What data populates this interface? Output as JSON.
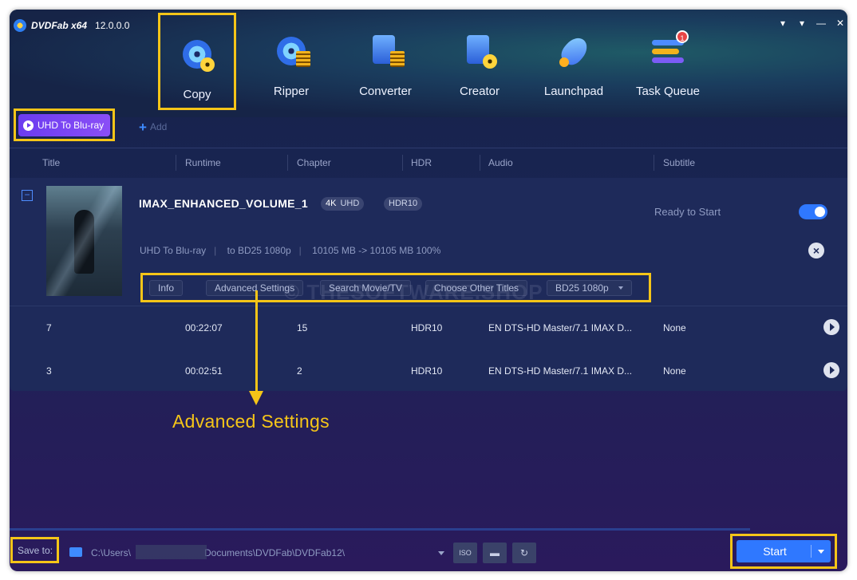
{
  "app": {
    "brand": "DVDFab x64",
    "version": "12.0.0.0"
  },
  "window_controls": [
    "▾",
    "▾",
    "—",
    "✕"
  ],
  "nav": {
    "copy": "Copy",
    "ripper": "Ripper",
    "converter": "Converter",
    "creator": "Creator",
    "launchpad": "Launchpad",
    "task_queue": "Task Queue",
    "task_queue_badge": "1"
  },
  "mode": {
    "label": "UHD To Blu-ray",
    "add_label": "Add"
  },
  "columns": [
    "Title",
    "Runtime",
    "Chapter",
    "HDR",
    "Audio",
    "Subtitle"
  ],
  "title_card": {
    "name": "IMAX_ENHANCED_VOLUME_1",
    "res_tag": "4K",
    "res_tag2": "UHD",
    "hdr_tag": "HDR10",
    "status": "Ready to Start",
    "meta_mode": "UHD To Blu-ray",
    "meta_target": "to BD25 1080p",
    "meta_size": "10105 MB -> 10105 MB 100%",
    "actions": {
      "info": "Info",
      "advanced": "Advanced Settings",
      "search": "Search Movie/TV",
      "choose": "Choose Other Titles",
      "profile": "BD25 1080p"
    }
  },
  "rows": [
    {
      "title": "7",
      "runtime": "00:22:07",
      "chapter": "15",
      "hdr": "HDR10",
      "audio": "EN  DTS-HD Master/7.1  IMAX D...",
      "subtitle": "None"
    },
    {
      "title": "3",
      "runtime": "00:02:51",
      "chapter": "2",
      "hdr": "HDR10",
      "audio": "EN  DTS-HD Master/7.1  IMAX D...",
      "subtitle": "None"
    }
  ],
  "annotation": "Advanced Settings",
  "watermark": "© THESOFTWARE.SHOP",
  "bottom": {
    "save_to": "Save to:",
    "path_start": "C:\\Users\\",
    "path_end": "Documents\\DVDFab\\DVDFab12\\",
    "iso_label": "ISO",
    "start": "Start"
  }
}
